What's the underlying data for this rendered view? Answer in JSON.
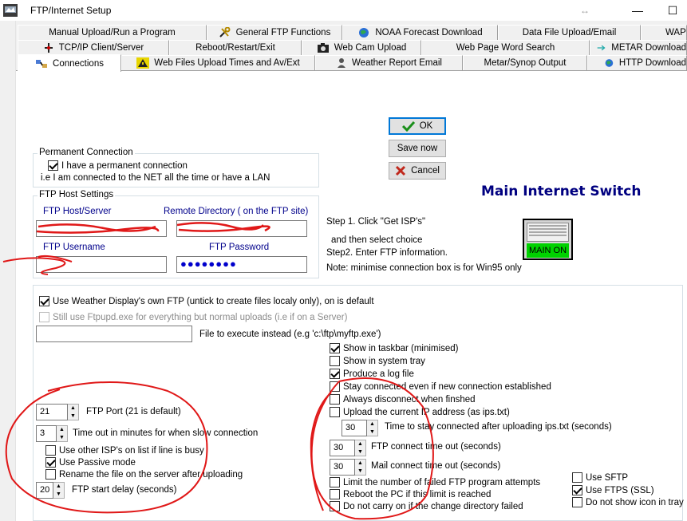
{
  "window": {
    "title": "FTP/Internet Setup",
    "minimize": "—",
    "maximize": "☐",
    "resize_glyph": "↔"
  },
  "tabs": {
    "row1": [
      {
        "label": "Manual Upload/Run a Program",
        "icon": ""
      },
      {
        "label": "General FTP Functions",
        "icon": "tools-icon"
      },
      {
        "label": "NOAA Forecast Download",
        "icon": "globe-icon"
      },
      {
        "label": "Data File Upload/Email",
        "icon": ""
      },
      {
        "label": "WAP",
        "icon": ""
      }
    ],
    "row2": [
      {
        "label": "TCP/IP Client/Server",
        "icon": "network-icon"
      },
      {
        "label": "Reboot/Restart/Exit",
        "icon": ""
      },
      {
        "label": "Web Cam Upload",
        "icon": "camera-icon"
      },
      {
        "label": "Web Page Word Search",
        "icon": ""
      },
      {
        "label": "METAR Download",
        "icon": "arrow-icon"
      }
    ],
    "row3": [
      {
        "label": "Connections",
        "icon": "connections-icon"
      },
      {
        "label": "Web Files Upload Times and  Av/Ext",
        "icon": "warning-icon"
      },
      {
        "label": "Weather Report Email",
        "icon": "person-icon"
      },
      {
        "label": "Metar/Synop Output",
        "icon": ""
      },
      {
        "label": "HTTP Download",
        "icon": "globe-icon"
      }
    ]
  },
  "buttons": {
    "ok": "OK",
    "save_now": "Save now",
    "cancel": "Cancel"
  },
  "main_switch": {
    "title": "Main Internet Switch",
    "state_label": "MAIN ON"
  },
  "permanent_connection": {
    "legend": "Permanent Connection",
    "checkbox_label": "I have a permanent connection",
    "checked": true,
    "note": "i.e I am connected to the NET all the time or have a LAN"
  },
  "ftp_host": {
    "legend": "FTP Host Settings",
    "host_label": "FTP Host/Server",
    "host_value": "",
    "remote_dir_label": "Remote Directory ( on the FTP site)",
    "remote_dir_value": "",
    "username_label": "FTP Username",
    "username_value": "",
    "password_label": "FTP Password",
    "password_value": "●●●●●●●●"
  },
  "steps": {
    "step1": "Step 1. Click   \"Get ISP's\"",
    "step1b": "and then select choice",
    "step2": "Step2. Enter FTP information.",
    "note": "Note: minimise connection box is for Win95 only"
  },
  "use_own_ftp": {
    "label": "Use Weather Display's own FTP  (untick to create files localy only), on is default",
    "checked": true
  },
  "ftpupd": {
    "label": "Still use Ftpupd.exe for everything but normal uploads (i.e if on a Server)",
    "checked": false
  },
  "file_to_execute": {
    "value": "",
    "label": "File to execute instead (e.g 'c:\\ftp\\myftp.exe')"
  },
  "right_options": [
    {
      "label": "Show in taskbar (minimised)",
      "checked": true
    },
    {
      "label": "Show in system tray",
      "checked": false
    },
    {
      "label": "Produce a log file",
      "checked": true
    },
    {
      "label": "Stay connected even if new connection established",
      "checked": false
    },
    {
      "label": "Always disconnect when finshed",
      "checked": false
    },
    {
      "label": "Upload the current IP address (as ips.txt)",
      "checked": false
    }
  ],
  "time_connected": {
    "value": "30",
    "label": "Time to stay connected after uploading ips.txt (seconds)"
  },
  "ftp_connect_timeout": {
    "value": "30",
    "label": "FTP connect time out (seconds)"
  },
  "mail_connect_timeout": {
    "value": "30",
    "label": "Mail connect time out (seconds)"
  },
  "bottom_right_options": [
    {
      "label": "Limit the number of failed FTP program attempts",
      "checked": false
    },
    {
      "label": "Reboot the PC if this limit is reached",
      "checked": false
    },
    {
      "label": "Do not carry on if the change directory failed",
      "checked": false
    }
  ],
  "far_right_options": [
    {
      "label": "Use SFTP",
      "checked": false
    },
    {
      "label": "Use FTPS (SSL)",
      "checked": true
    },
    {
      "label": "Do not show icon in tray",
      "checked": false
    }
  ],
  "ftp_port": {
    "value": "21",
    "label": "FTP Port (21 is default)"
  },
  "timeout_minutes": {
    "value": "3",
    "label": "Time out in minutes for when slow connection"
  },
  "left_options": [
    {
      "label": "Use other ISP's on list if line is busy",
      "checked": false
    },
    {
      "label": "Use Passive mode",
      "checked": true
    },
    {
      "label": "Rename the file on the server after uploading",
      "checked": false
    }
  ],
  "start_delay": {
    "value": "20",
    "label": "FTP start delay (seconds)"
  }
}
